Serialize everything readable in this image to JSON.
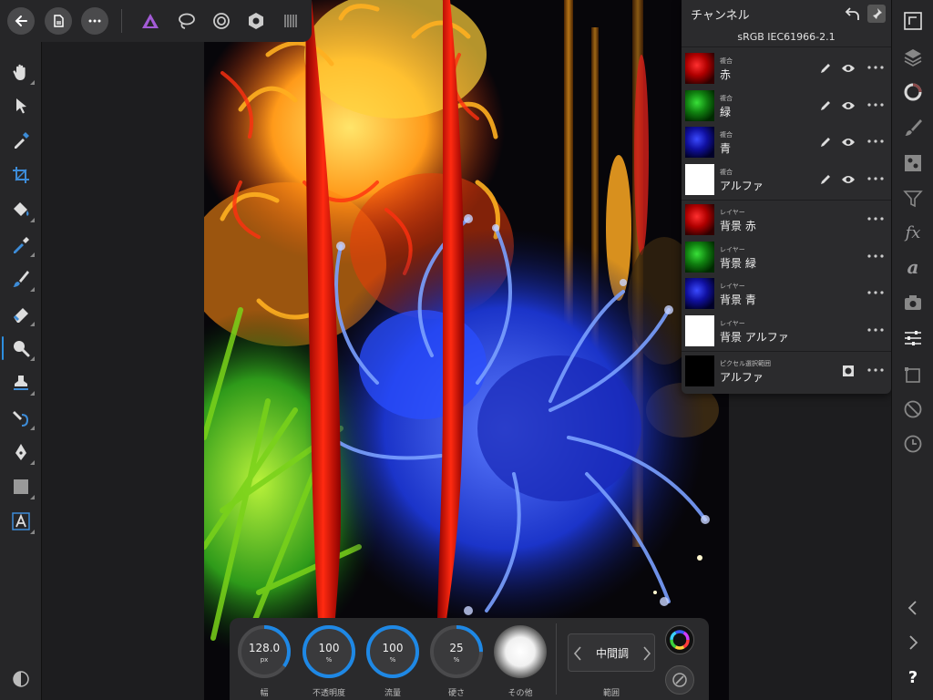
{
  "panel": {
    "title": "チャンネル",
    "profile": "sRGB IEC61966-2.1",
    "composite_rows": [
      {
        "kind": "複合",
        "label": "赤",
        "thumb": "red"
      },
      {
        "kind": "複合",
        "label": "緑",
        "thumb": "green"
      },
      {
        "kind": "複合",
        "label": "青",
        "thumb": "blue"
      },
      {
        "kind": "複合",
        "label": "アルファ",
        "thumb": "white"
      }
    ],
    "layer_rows": [
      {
        "kind": "レイヤー",
        "label": "背景 赤",
        "thumb": "red"
      },
      {
        "kind": "レイヤー",
        "label": "背景 緑",
        "thumb": "green"
      },
      {
        "kind": "レイヤー",
        "label": "背景 青",
        "thumb": "blue"
      },
      {
        "kind": "レイヤー",
        "label": "背景 アルファ",
        "thumb": "white"
      }
    ],
    "selection_row": {
      "kind": "ピクセル選択範囲",
      "label": "アルファ",
      "thumb": "black"
    }
  },
  "context_toolbar": {
    "width": {
      "value": "128.0",
      "unit": "px",
      "label": "幅",
      "level": 0.35
    },
    "opacity": {
      "value": "100",
      "unit": "%",
      "label": "不透明度",
      "level": 1.0
    },
    "flow": {
      "value": "100",
      "unit": "%",
      "label": "流量",
      "level": 1.0
    },
    "hardness": {
      "value": "25",
      "unit": "%",
      "label": "硬さ",
      "level": 0.25
    },
    "more_label": "その他",
    "range": {
      "value": "中間調",
      "label": "範囲"
    }
  },
  "colors": {
    "accent": "#1e88e5",
    "panel_bg": "#2b2b2d",
    "toolbar_bg": "#262628",
    "affinity_purple": "#a35bd6"
  },
  "left_tools": [
    "hand-icon",
    "move-icon",
    "color-picker-icon",
    "crop-icon",
    "flood-fill-icon",
    "selection-brush-icon",
    "paint-brush-icon",
    "eraser-icon",
    "dodge-icon",
    "clone-icon",
    "smudge-icon",
    "pen-icon",
    "rectangle-icon",
    "text-icon"
  ],
  "right_tools": [
    "navigator-icon",
    "layers-icon",
    "channels-icon",
    "brushes-icon",
    "adjustments-icon",
    "filter-icon",
    "fx-icon",
    "text-styles-icon",
    "camera-icon",
    "sliders-icon",
    "transform-icon",
    "block-icon",
    "history-icon",
    "chevron-left-icon",
    "chevron-right-icon",
    "help-icon"
  ]
}
